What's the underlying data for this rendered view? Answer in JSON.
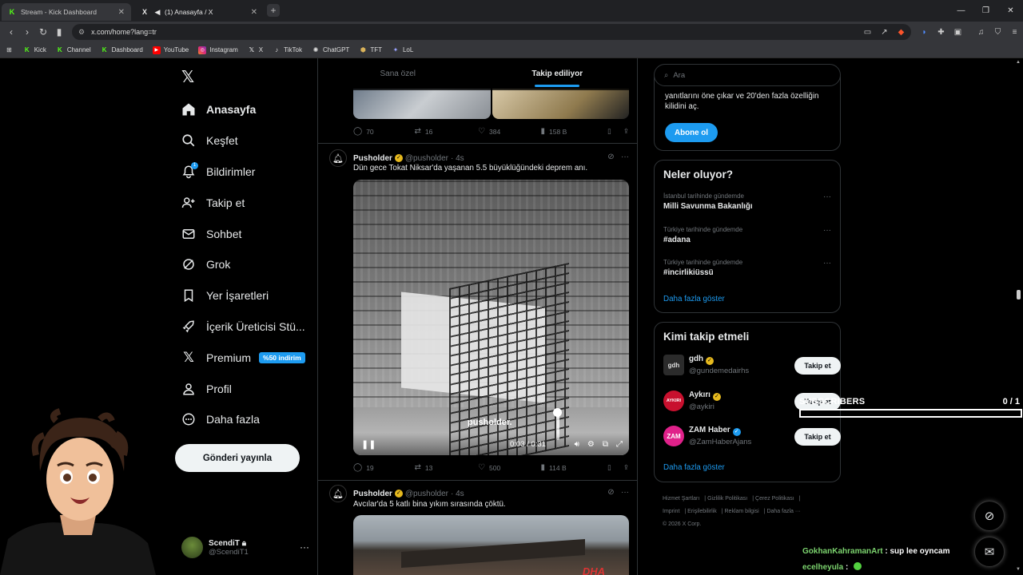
{
  "browser": {
    "tabs": [
      {
        "label": "Stream - Kick Dashboard",
        "favicon": "K"
      },
      {
        "label": "(1) Anasayfa / X",
        "favicon": "X"
      }
    ],
    "new_tab": "+",
    "url": "x.com/home?lang=tr",
    "bookmarks": [
      "Kick",
      "Channel",
      "Dashboard",
      "YouTube",
      "Instagram",
      "X",
      "TikTok",
      "ChatGPT",
      "TFT",
      "LoL"
    ]
  },
  "x": {
    "nav": [
      {
        "label": "Anasayfa",
        "icon": "home-icon"
      },
      {
        "label": "Keşfet",
        "icon": "search-icon"
      },
      {
        "label": "Bildirimler",
        "icon": "bell-icon",
        "badge": "1"
      },
      {
        "label": "Takip et",
        "icon": "add-user-icon"
      },
      {
        "label": "Sohbet",
        "icon": "mail-icon"
      },
      {
        "label": "Grok",
        "icon": "grok-icon"
      },
      {
        "label": "Yer İşaretleri",
        "icon": "bookmark-icon"
      },
      {
        "label": "İçerik Üreticisi Stü...",
        "icon": "rocket-icon"
      },
      {
        "label": "Premium",
        "icon": "x-icon",
        "badge": "%50 indirim"
      },
      {
        "label": "Profil",
        "icon": "person-icon"
      },
      {
        "label": "Daha fazla",
        "icon": "more-circle-icon"
      }
    ],
    "post_button": "Gönderi yayınla",
    "account": {
      "name": "ScendiT",
      "handle": "@ScendiT1"
    }
  },
  "feed": {
    "tabs": [
      "Sana özel",
      "Takip ediliyor"
    ],
    "prev_post_metrics": {
      "replies": "70",
      "reposts": "16",
      "likes": "384",
      "views": "158 B"
    },
    "posts": [
      {
        "author": "Pusholder",
        "handle": "@pusholder",
        "time": "· 4s",
        "text": "Dün gece Tokat Niksar'da yaşanan 5.5 büyüklüğündeki deprem anı.",
        "video_watermark": "pusholder.",
        "video_time": "0:03 / 0:31",
        "metrics": {
          "replies": "19",
          "reposts": "13",
          "likes": "500",
          "views": "114 B"
        }
      },
      {
        "author": "Pusholder",
        "handle": "@pusholder",
        "time": "· 4s",
        "text": "Avcılar'da 5 katlı bina yıkım sırasında çöktü.",
        "image_watermark": "DHA"
      }
    ]
  },
  "right": {
    "search_placeholder": "Ara",
    "premium_text": "yanıtlarını öne çıkar ve 20'den fazla özelliğin kilidini aç.",
    "subscribe_button": "Abone ol",
    "trends_title": "Neler oluyor?",
    "trends": [
      {
        "context": "İstanbul tarihinde gündemde",
        "topic": "Milli Savunma Bakanlığı"
      },
      {
        "context": "Türkiye tarihinde gündemde",
        "topic": "#adana"
      },
      {
        "context": "Türkiye tarihinde gündemde",
        "topic": "#incirlikiüssü"
      }
    ],
    "show_more": "Daha fazla göster",
    "who_title": "Kimi takip etmeli",
    "who": [
      {
        "name": "gdh",
        "handle": "@gundemedairhs",
        "avatar": "gdh",
        "verified": "gold"
      },
      {
        "name": "Aykırı",
        "handle": "@aykiri",
        "avatar": "AYKIRI",
        "verified": "gold"
      },
      {
        "name": "ZAM Haber",
        "handle": "@ZamHaberAjans",
        "avatar": "ZAM",
        "verified": "blue"
      }
    ],
    "follow_button": "Takip et",
    "footer_links": [
      "Hizmet Şartları",
      "Gizlilik Politikası",
      "Çerez Politikası",
      "Imprint",
      "Erişilebilirlik",
      "Reklam bilgisi",
      "Daha fazla ···",
      "© 2026 X Corp."
    ]
  },
  "overlay": {
    "subscribers_label": "SUBSCRIBERS",
    "subscribers_count": "0 / 1",
    "chat": [
      {
        "user": "GokhanKahramanArt",
        "message": ": sup lee oyncam"
      },
      {
        "user": "ecelheyula",
        "message": ":"
      }
    ]
  },
  "colors": {
    "accent": "#1d9bf0",
    "kick": "#53fc18",
    "background": "#000000",
    "gold_verified": "#e6b91e"
  }
}
